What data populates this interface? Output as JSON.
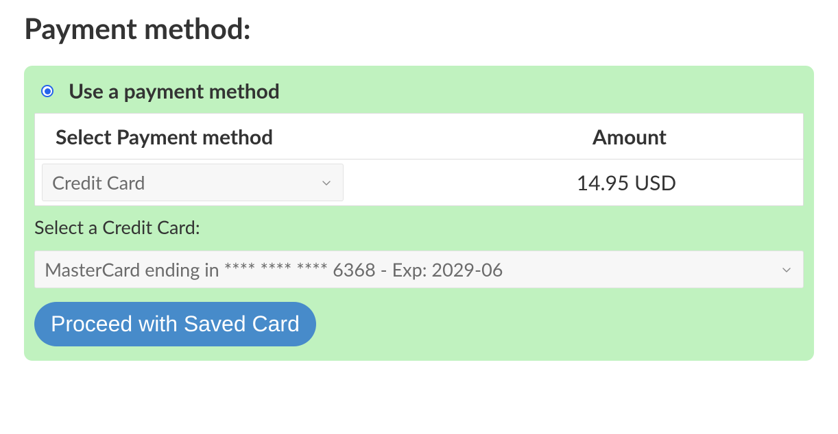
{
  "page": {
    "title": "Payment method:"
  },
  "panel": {
    "radio_label": "Use a payment method",
    "table": {
      "header": {
        "method": "Select Payment method",
        "amount": "Amount"
      },
      "row": {
        "method_selected": "Credit Card",
        "amount": "14.95 USD"
      }
    },
    "card_select": {
      "label": "Select a Credit Card:",
      "selected": "MasterCard ending in **** **** **** 6368 - Exp: 2029-06"
    },
    "proceed_button": "Proceed with Saved Card"
  }
}
